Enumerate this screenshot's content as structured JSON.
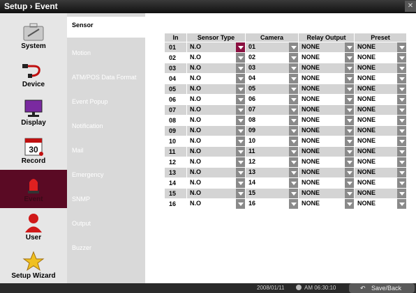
{
  "window": {
    "title": "Setup › Event",
    "close_glyph": "✕"
  },
  "nav": [
    {
      "label": "System",
      "icon": "briefcase-icon"
    },
    {
      "label": "Device",
      "icon": "cable-icon"
    },
    {
      "label": "Display",
      "icon": "monitor-icon"
    },
    {
      "label": "Record",
      "icon": "calendar-icon",
      "icon_text": "30"
    },
    {
      "label": "Event",
      "icon": "siren-icon",
      "active": true
    },
    {
      "label": "User",
      "icon": "user-icon"
    },
    {
      "label": "Setup Wizard",
      "icon": "wizard-star-icon"
    }
  ],
  "subnav": [
    "Sensor",
    "Motion",
    "ATM/POS Data Format",
    "Event Popup",
    "Notification",
    "Mail",
    "Emergency",
    "SNMP",
    "Output",
    "Buzzer"
  ],
  "table": {
    "headers": [
      "In",
      "Sensor Type",
      "Camera",
      "Relay Output",
      "Preset"
    ],
    "rows": [
      [
        "01",
        "N.O",
        "01",
        "NONE",
        "NONE"
      ],
      [
        "02",
        "N.O",
        "02",
        "NONE",
        "NONE"
      ],
      [
        "03",
        "N.O",
        "03",
        "NONE",
        "NONE"
      ],
      [
        "04",
        "N.O",
        "04",
        "NONE",
        "NONE"
      ],
      [
        "05",
        "N.O",
        "05",
        "NONE",
        "NONE"
      ],
      [
        "06",
        "N.O",
        "06",
        "NONE",
        "NONE"
      ],
      [
        "07",
        "N.O",
        "07",
        "NONE",
        "NONE"
      ],
      [
        "08",
        "N.O",
        "08",
        "NONE",
        "NONE"
      ],
      [
        "09",
        "N.O",
        "09",
        "NONE",
        "NONE"
      ],
      [
        "10",
        "N.O",
        "10",
        "NONE",
        "NONE"
      ],
      [
        "11",
        "N.O",
        "11",
        "NONE",
        "NONE"
      ],
      [
        "12",
        "N.O",
        "12",
        "NONE",
        "NONE"
      ],
      [
        "13",
        "N.O",
        "13",
        "NONE",
        "NONE"
      ],
      [
        "14",
        "N.O",
        "14",
        "NONE",
        "NONE"
      ],
      [
        "15",
        "N.O",
        "15",
        "NONE",
        "NONE"
      ],
      [
        "16",
        "N.O",
        "16",
        "NONE",
        "NONE"
      ]
    ]
  },
  "status": {
    "datetime": "2008/01/11",
    "time": "AM 06:30:10",
    "save_label": "Save/Back"
  },
  "colors": {
    "accent": "#8a1040",
    "active_nav": "#5a0a24"
  }
}
